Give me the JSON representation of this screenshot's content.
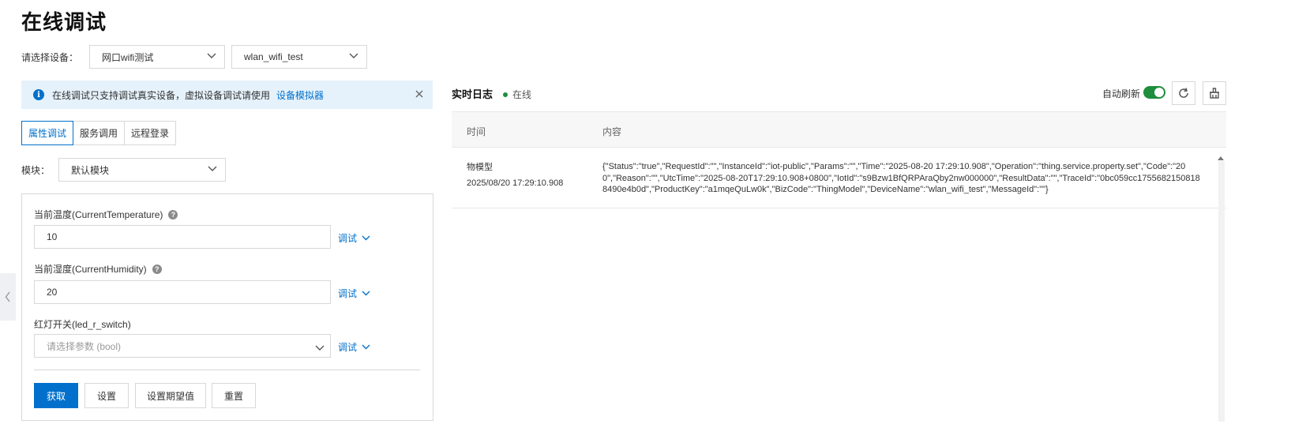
{
  "page": {
    "title": "在线调试"
  },
  "device_select": {
    "label": "请选择设备：",
    "product_value": "网口wifi测试",
    "device_value": "wlan_wifi_test"
  },
  "notice": {
    "text": "在线调试只支持调试真实设备，虚拟设备调试请使用",
    "link": "设备模拟器"
  },
  "tabs": [
    {
      "label": "属性调试",
      "active": true
    },
    {
      "label": "服务调用",
      "active": false
    },
    {
      "label": "远程登录",
      "active": false
    }
  ],
  "module": {
    "label": "模块：",
    "value": "默认模块"
  },
  "properties": [
    {
      "label": "当前温度(CurrentTemperature)",
      "value": "10",
      "has_help": true,
      "action": "调试"
    },
    {
      "label": "当前湿度(CurrentHumidity)",
      "value": "20",
      "has_help": true,
      "action": "调试"
    },
    {
      "label": "红灯开关(led_r_switch)",
      "placeholder": "请选择参数 (bool)",
      "has_help": false,
      "action": "调试"
    }
  ],
  "buttons": {
    "get": "获取",
    "set": "设置",
    "set_expected": "设置期望值",
    "reset": "重置"
  },
  "log": {
    "title": "实时日志",
    "status": "在线",
    "auto_refresh_label": "自动刷新",
    "auto_refresh_on": true,
    "columns": {
      "time": "时间",
      "content": "内容"
    },
    "rows": [
      {
        "type": "物模型",
        "time": "2025/08/20 17:29:10.908",
        "content": "{\"Status\":\"true\",\"RequestId\":\"\",\"InstanceId\":\"iot-public\",\"Params\":\"\",\"Time\":\"2025-08-20 17:29:10.908\",\"Operation\":\"thing.service.property.set\",\"Code\":\"200\",\"Reason\":\"\",\"UtcTime\":\"2025-08-20T17:29:10.908+0800\",\"IotId\":\"s9Bzw1BfQRPAraQby2nw000000\",\"ResultData\":\"\",\"TraceId\":\"0bc059cc17556821508188490e4b0d\",\"ProductKey\":\"a1mqeQuLw0k\",\"BizCode\":\"ThingModel\",\"DeviceName\":\"wlan_wifi_test\",\"MessageId\":\"\"}"
      }
    ]
  },
  "colors": {
    "primary": "#0070cc",
    "online": "#1e8e3e",
    "notice_bg": "#e6f2fb"
  },
  "icons": [
    "info-icon",
    "close-icon",
    "chevron-down-icon",
    "help-icon",
    "refresh-icon",
    "clear-icon",
    "chevron-left-icon"
  ]
}
